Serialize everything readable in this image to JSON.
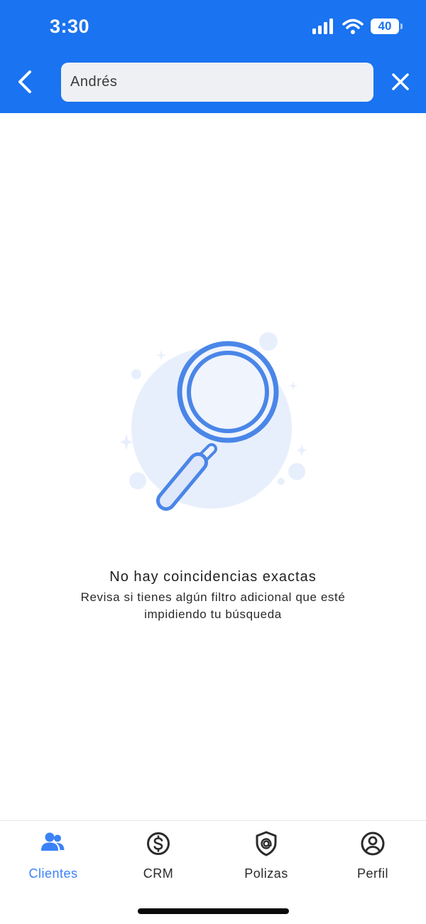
{
  "status_bar": {
    "time": "3:30",
    "battery": "40",
    "icons": [
      "signal-icon",
      "wifi-icon",
      "battery-icon"
    ]
  },
  "search": {
    "value": "Andrés",
    "back_icon": "chevron-left-icon",
    "clear_icon": "close-icon"
  },
  "empty_state": {
    "illustration": "magnifier-illustration",
    "title": "No hay coincidencias exactas",
    "subtitle": "Revisa si tienes algún filtro adicional que esté impidiendo tu búsqueda"
  },
  "bottom_nav": {
    "items": [
      {
        "label": "Clientes",
        "icon": "users-icon",
        "active": true
      },
      {
        "label": "CRM",
        "icon": "dollar-circle-icon",
        "active": false
      },
      {
        "label": "Polizas",
        "icon": "shield-at-icon",
        "active": false
      },
      {
        "label": "Perfil",
        "icon": "user-circle-icon",
        "active": false
      }
    ]
  },
  "colors": {
    "primary": "#1a73f0",
    "active_tab": "#3b82f6",
    "illustration_blue": "#4a86e8",
    "illustration_bg": "#e8effc"
  }
}
